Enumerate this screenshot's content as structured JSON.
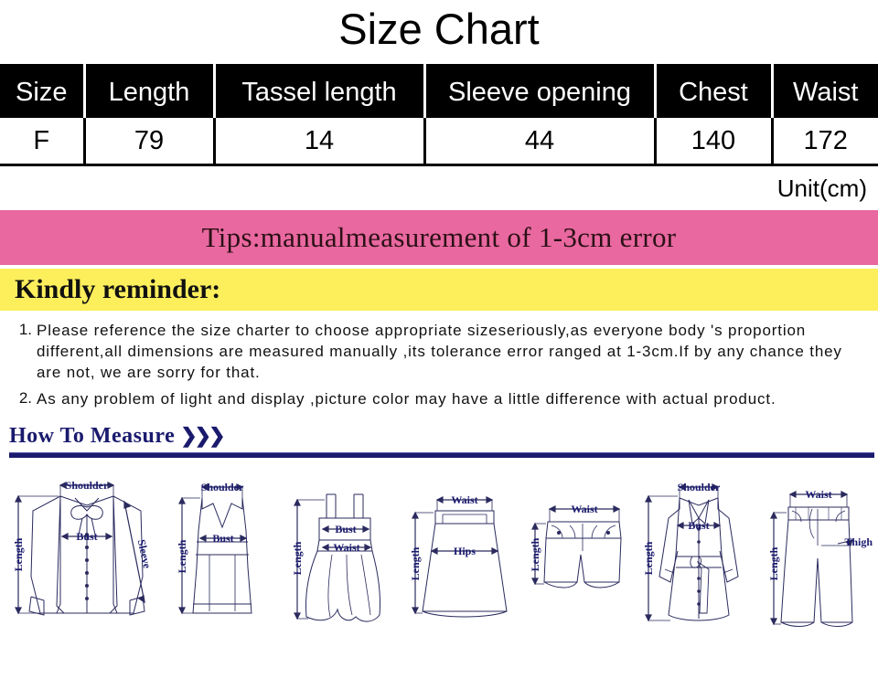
{
  "page": {
    "title": "Size Chart",
    "unit_note": "Unit(cm)"
  },
  "size_table": {
    "headers": [
      "Size",
      "Length",
      "Tassel length",
      "Sleeve opening",
      "Chest",
      "Waist"
    ],
    "rows": [
      [
        "F",
        "79",
        "14",
        "44",
        "140",
        "172"
      ]
    ]
  },
  "tips_banner": {
    "text": "Tips:manualmeasurement of 1-3cm error",
    "background": "#e8689f"
  },
  "reminder_banner": {
    "text": "Kindly reminder:",
    "background": "#fdef5c"
  },
  "notes": [
    {
      "number": "1.",
      "text": "Please reference the size charter to choose appropriate sizeseriously,as everyone body 's proportion different,all dimensions are measured manually ,its tolerance error ranged at 1-3cm.If by any chance they are not, we are sorry for that."
    },
    {
      "number": "2.",
      "text": "As any problem of light and display ,picture color may have a little difference with actual product."
    }
  ],
  "how_to_measure": {
    "title": "How To Measure",
    "chevrons": "»›",
    "accent_color": "#1a1a6e",
    "diagrams": [
      {
        "name": "blouse",
        "labels": [
          "Shoulder",
          "Bust",
          "Sleeve",
          "Length"
        ]
      },
      {
        "name": "camisole",
        "labels": [
          "Shoulder",
          "Bust",
          "Length"
        ]
      },
      {
        "name": "dress",
        "labels": [
          "Bust",
          "Waist",
          "Length"
        ]
      },
      {
        "name": "skirt",
        "labels": [
          "Waist",
          "Hips",
          "Length"
        ]
      },
      {
        "name": "shorts",
        "labels": [
          "Waist",
          "Length"
        ]
      },
      {
        "name": "coat",
        "labels": [
          "Shoulder",
          "Bust",
          "Length"
        ]
      },
      {
        "name": "pants",
        "labels": [
          "Waist",
          "Thigh",
          "Length"
        ]
      }
    ]
  }
}
